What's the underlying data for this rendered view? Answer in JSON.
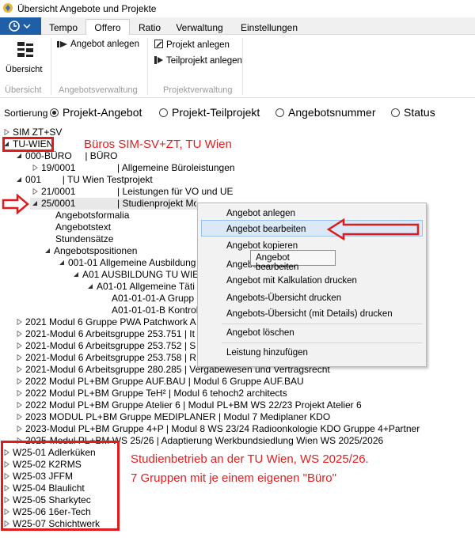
{
  "window": {
    "title": "Übersicht Angebote und Projekte"
  },
  "tabs": [
    "Tempo",
    "Offero",
    "Ratio",
    "Verwaltung",
    "Einstellungen"
  ],
  "ribbon": {
    "overview_label": "Übersicht",
    "overview_group": "Übersicht",
    "offer_create": "Angebot anlegen",
    "offer_group": "Angebotsverwaltung",
    "project_create": "Projekt anlegen",
    "subproject_create": "Teilprojekt anlegen",
    "project_group": "Projektverwaltung"
  },
  "sort": {
    "label": "Sortierung",
    "options": [
      "Projekt-Angebot",
      "Projekt-Teilprojekt",
      "Angebotsnummer",
      "Status"
    ],
    "selected": "Projekt-Angebot"
  },
  "tree": [
    "SIM ZT+SV",
    "TU-WIEN",
    "000-BÜRO     | BÜRO",
    "19/0001",
    "| Allgemeine Büroleistungen",
    "001        | TU Wien Testprojekt",
    "21/0001",
    "| Leistungen für VO und UE",
    "25/0001",
    "| Studienprojekt Modul 2025/26",
    "Angebotsformalia",
    "Angebotstext",
    "Stundensätze",
    "Angebotspositionen",
    "001-01 Allgemeine Ausbildung",
    "A01 AUSBILDUNG TU WIE",
    "A01-01 Allgemeine Täti",
    "A01-01-01-A Grupp",
    "A01-01-01-B Kontrol",
    "2021 Modul 6 Gruppe PWA Patchwork A",
    "2021-Modul 6 Arbeitsgruppe 253.751 | It",
    "2021-Modul 6 Arbeitsgruppe 253.752 | S",
    "2021-Modul 6 Arbeitsgruppe 253.758 | R",
    "2021-Modul 6 Arbeitsgruppe 280.285 | Vergabewesen und Vertragsrecht",
    "2022 Modul PL+BM Gruppe AUF.BAU | Modul 6 Gruppe AUF.BAU",
    "2022 Modul PL+BM Gruppe TeH² | Modul 6 tehoch2 architects",
    "2022 Modul PL+BM Gruppe Atelier 6 | Modul PL+BM WS 22/23 Projekt Atelier 6",
    "2023 MODUL PL+BM Gruppe MEDIPLANER | Modul 7 Mediplaner KDO",
    "2023-Modul PL+BM Gruppe 4+P | Modul 8 WS 23/24 Radioonkologie KDO Gruppe 4+Partner",
    "2025-Modul PL+BM WS 25/26 | Adaptierung Werkbundsiedlung Wien WS 2025/2026",
    "W25-01 Adlerküken",
    "W25-02 K2RMS",
    "W25-03 JFFM",
    "W25-04 Blaulicht",
    "W25-05 Sharkytec",
    "W25-06 16er-Tech",
    "W25-07 Schichtwerk"
  ],
  "context_menu": [
    "Angebot anlegen",
    "Angebot bearbeiten",
    "Angebot kopieren",
    "Angebot drucken",
    "Angebot mit Kalkulation drucken",
    "Angebots-Übersicht drucken",
    "Angebots-Übersicht (mit Details) drucken",
    "Angebot löschen",
    "Leistung hinzufügen"
  ],
  "tooltip": "Angebot bearbeiten",
  "annotations": {
    "bueros": "Büros SIM-SV+ZT, TU Wien",
    "studienbetrieb_line1": "Studienbetrieb an der TU Wien, WS 2025/26.",
    "studienbetrieb_line2": "7 Gruppen mit je einem eigenen \"Büro\""
  },
  "colors": {
    "annotation_red": "#e02020",
    "accent_blue": "#1f5fa8",
    "highlight": "#dbe9f7"
  }
}
